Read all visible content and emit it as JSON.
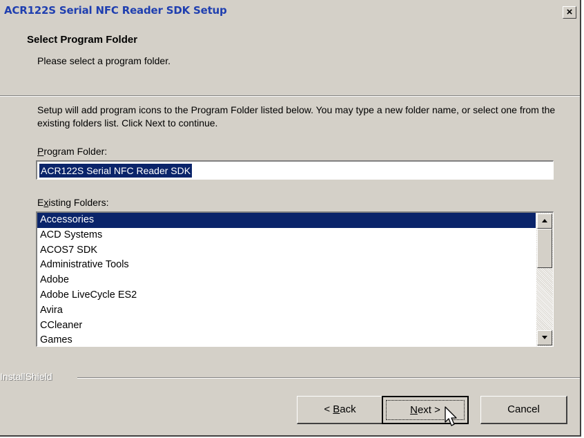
{
  "window": {
    "title": "ACR122S Serial NFC Reader SDK Setup",
    "close_glyph": "×"
  },
  "header": {
    "title": "Select Program Folder",
    "subtitle": "Please select a program folder."
  },
  "body": {
    "description": "Setup will add program icons to the Program Folder listed below.  You may type a new folder name, or select one from the existing folders list.  Click Next to continue.",
    "program_folder_label": {
      "accel": "P",
      "rest": "rogram Folder:"
    },
    "program_folder_value": "ACR122S Serial NFC Reader SDK",
    "existing_folders_label": {
      "pre": "E",
      "accel": "x",
      "rest": "isting Folders:"
    },
    "existing_folders": [
      "Accessories",
      "ACD Systems",
      "ACOS7 SDK",
      "Administrative Tools",
      "Adobe",
      "Adobe LiveCycle ES2",
      "Avira",
      "CCleaner",
      "Games"
    ],
    "selected_folder": "Accessories"
  },
  "footer": {
    "brand": "InstallShield",
    "back_button": {
      "pre": "< ",
      "accel": "B",
      "rest": "ack"
    },
    "next_button": {
      "accel": "N",
      "rest": "ext >"
    },
    "cancel_button": "Cancel"
  },
  "icons": {
    "scroll_up": "scroll-up-arrow-icon",
    "scroll_down": "scroll-down-arrow-icon",
    "cursor": "mouse-pointer-icon"
  },
  "colors": {
    "selection": "#0a246a",
    "title_text": "#1f3fb0",
    "dialog_face": "#d4d0c8"
  }
}
